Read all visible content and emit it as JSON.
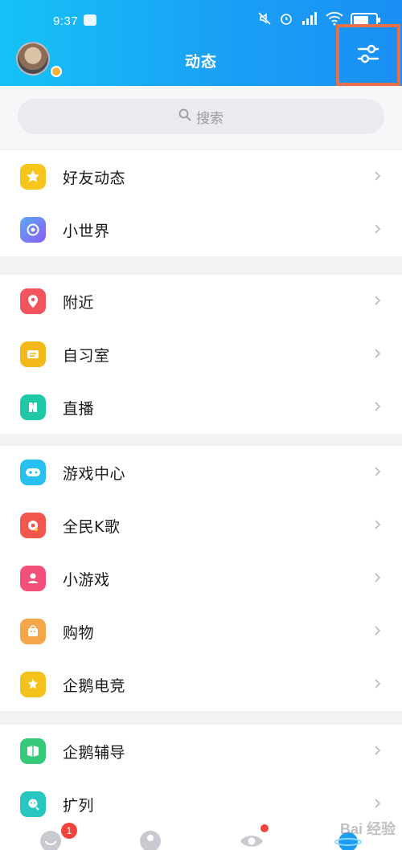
{
  "status_bar": {
    "time": "9:37"
  },
  "header": {
    "title": "动态"
  },
  "search": {
    "placeholder": "搜索"
  },
  "colors": {
    "header_blue": "#1aa0f5",
    "highlight_box": "#e8704a",
    "badge_red": "#f4433c"
  },
  "groups": [
    {
      "items": [
        {
          "label": "好友动态",
          "icon": "star-icon",
          "color": "#f7c51b"
        },
        {
          "label": "小世界",
          "icon": "planet-icon",
          "color": "#7a63f2"
        }
      ]
    },
    {
      "items": [
        {
          "label": "附近",
          "icon": "location-pin-icon",
          "color": "#f3545d"
        },
        {
          "label": "自习室",
          "icon": "study-room-icon",
          "color": "#f5b819"
        },
        {
          "label": "直播",
          "icon": "live-icon",
          "color": "#1fc9a3"
        }
      ]
    },
    {
      "items": [
        {
          "label": "游戏中心",
          "icon": "gamepad-icon",
          "color": "#27c0f0"
        },
        {
          "label": "全民K歌",
          "icon": "karaoke-icon",
          "color": "#f2574d"
        },
        {
          "label": "小游戏",
          "icon": "mini-game-icon",
          "color": "#f2507a"
        },
        {
          "label": "购物",
          "icon": "shopping-icon",
          "color": "#f5a54a"
        },
        {
          "label": "企鹅电竞",
          "icon": "esports-icon",
          "color": "#f5c21b"
        }
      ]
    },
    {
      "items": [
        {
          "label": "企鹅辅导",
          "icon": "tutoring-icon",
          "color": "#36c97a"
        },
        {
          "label": "扩列",
          "icon": "make-friends-icon",
          "color": "#27c7c0"
        }
      ]
    }
  ],
  "tabbar": {
    "message_badge": "1"
  },
  "watermark": "Bai 经验"
}
